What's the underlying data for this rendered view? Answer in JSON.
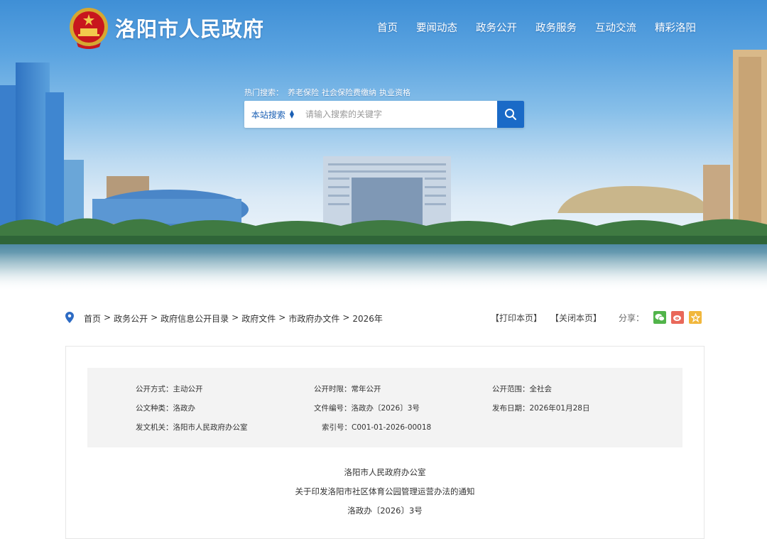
{
  "header": {
    "site_title": "洛阳市人民政府",
    "nav": [
      "首页",
      "要闻动态",
      "政务公开",
      "政务服务",
      "互动交流",
      "精彩洛阳"
    ]
  },
  "search": {
    "hot_label": "热门搜索：",
    "hot_terms": [
      "养老保险",
      "社会保险费缴纳",
      "执业资格"
    ],
    "scope_label": "本站搜索",
    "placeholder": "请输入搜索的关键字"
  },
  "breadcrumb": [
    "首页",
    "政务公开",
    "政府信息公开目录",
    "政府文件",
    "市政府办文件",
    "2026年"
  ],
  "breadcrumb_sep": ">",
  "tools": {
    "print": "【打印本页】",
    "close": "【关闭本页】",
    "share": "分享："
  },
  "meta": {
    "open_method": {
      "label": "公开方式：",
      "value": "主动公开"
    },
    "open_period": {
      "label": "公开时限：",
      "value": "常年公开"
    },
    "open_scope": {
      "label": "公开范围：",
      "value": "全社会"
    },
    "doc_type": {
      "label": "公文种类：",
      "value": "洛政办"
    },
    "doc_number": {
      "label": "文件编号：",
      "value": "洛政办〔2026〕3号"
    },
    "publish_date": {
      "label": "发布日期：",
      "value": "2026年01月28日"
    },
    "issuer": {
      "label": "发文机关：",
      "value": "洛阳市人民政府办公室"
    },
    "index_no": {
      "label": "索引号：",
      "value": "C001-01-2026-00018"
    }
  },
  "document": {
    "office": "洛阳市人民政府办公室",
    "title": "关于印发洛阳市社区体育公园管理运营办法的通知",
    "number": "洛政办〔2026〕3号"
  },
  "colors": {
    "primary": "#1a6ac7",
    "wechat": "#51b44a",
    "weibo": "#e9685a",
    "favorite": "#f1b73c"
  }
}
